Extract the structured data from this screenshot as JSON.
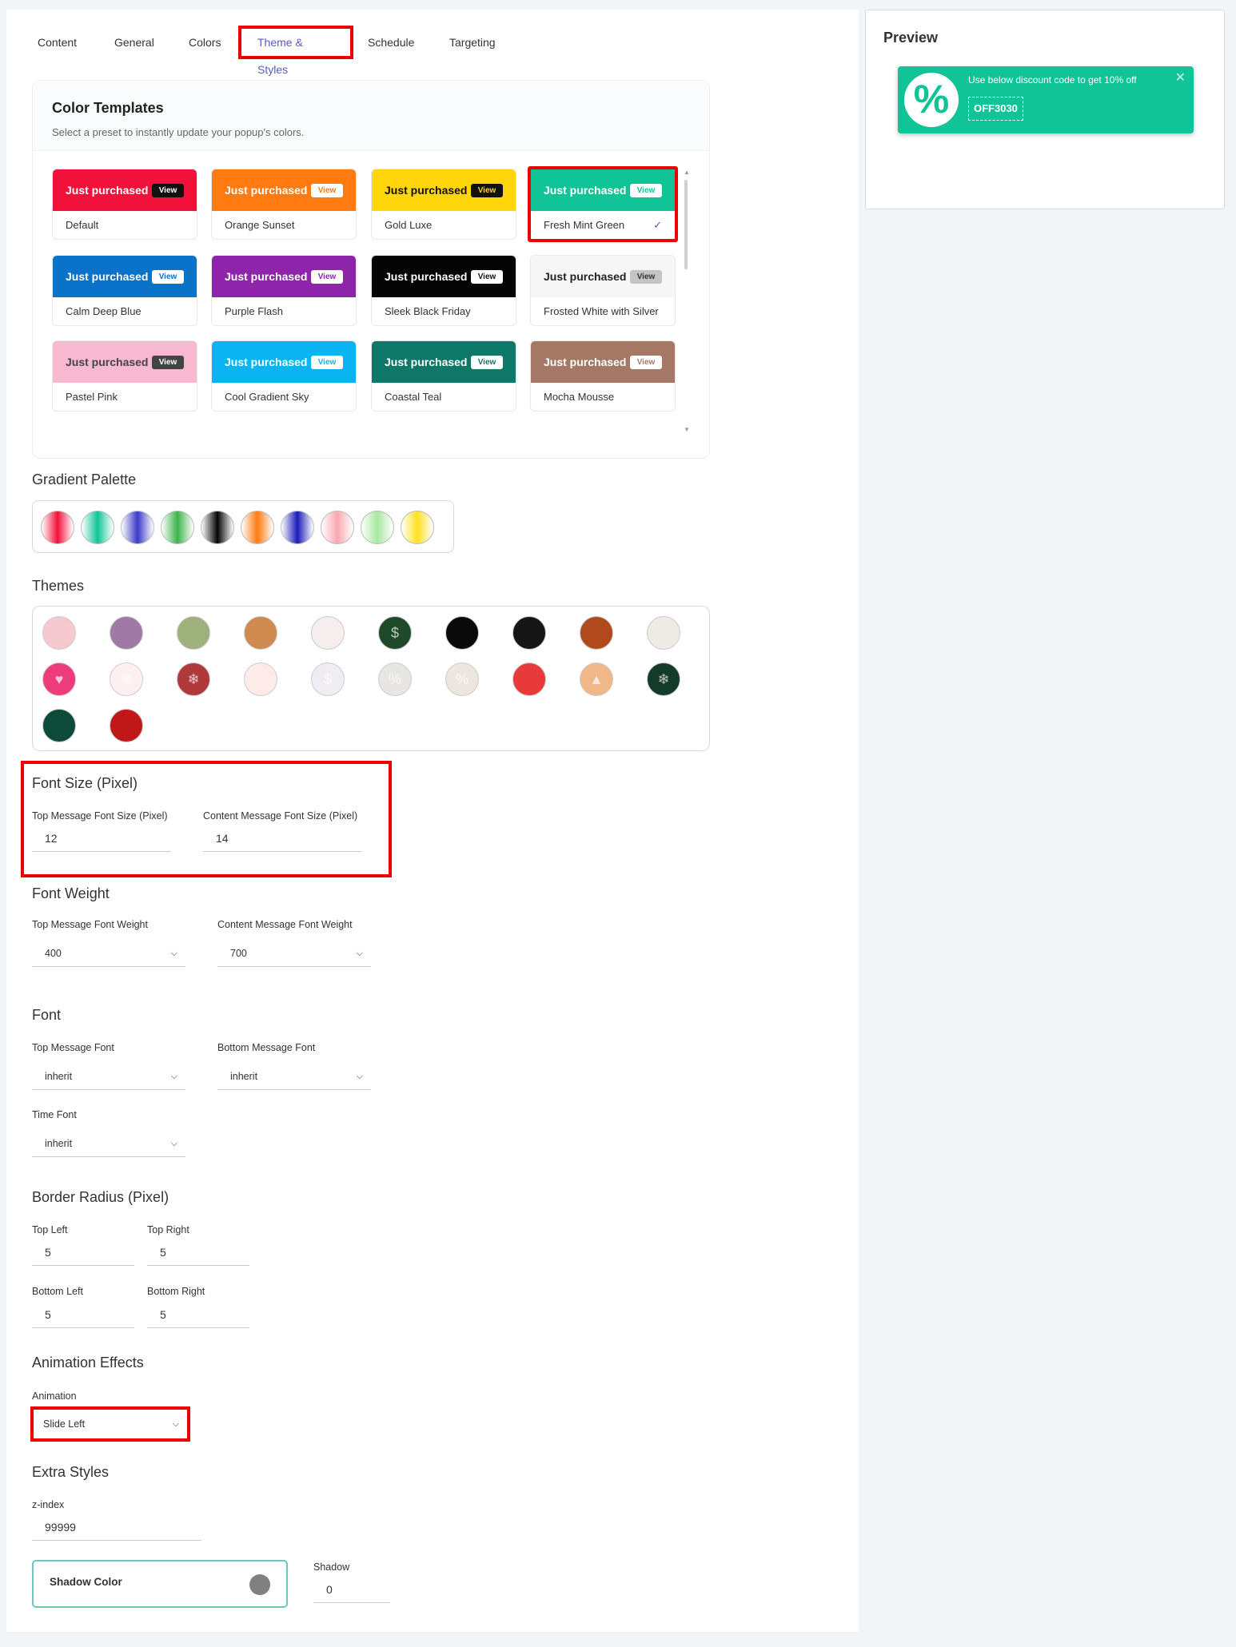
{
  "tabs": [
    "Content",
    "General",
    "Colors",
    "Theme & Styles",
    "Schedule",
    "Targeting"
  ],
  "color_templates": {
    "title": "Color Templates",
    "subtitle": "Select a preset to instantly update your popup's colors.",
    "badge_text": "Just purchased",
    "view_text": "View",
    "selected_check": "✓",
    "items": [
      {
        "name": "Default",
        "bg": "#f2113a",
        "fg": "#ffffff",
        "vbg": "#111111",
        "vfg": "#ffffff"
      },
      {
        "name": "Orange Sunset",
        "bg": "#ff7a10",
        "fg": "#ffffff",
        "vbg": "#ffffff",
        "vfg": "#ff7a10"
      },
      {
        "name": "Gold Luxe",
        "bg": "#ffd60a",
        "fg": "#111111",
        "vbg": "#111111",
        "vfg": "#ffd60a"
      },
      {
        "name": "Fresh Mint Green",
        "bg": "#10c498",
        "fg": "#ffffff",
        "vbg": "#ffffff",
        "vfg": "#10c498"
      },
      {
        "name": "Calm Deep Blue",
        "bg": "#0a72c8",
        "fg": "#ffffff",
        "vbg": "#ffffff",
        "vfg": "#0a72c8"
      },
      {
        "name": "Purple Flash",
        "bg": "#8e24aa",
        "fg": "#ffffff",
        "vbg": "#ffffff",
        "vfg": "#8e24aa"
      },
      {
        "name": "Sleek Black Friday",
        "bg": "#050505",
        "fg": "#ffffff",
        "vbg": "#ffffff",
        "vfg": "#111111"
      },
      {
        "name": "Frosted White with Silver",
        "bg": "#f6f6f6",
        "fg": "#222222",
        "vbg": "#c4c4c4",
        "vfg": "#333333"
      },
      {
        "name": "Pastel Pink",
        "bg": "#f8b8d0",
        "fg": "#444444",
        "vbg": "#444444",
        "vfg": "#ffffff"
      },
      {
        "name": "Cool Gradient Sky",
        "bg": "#0ab4f2",
        "fg": "#ffffff",
        "vbg": "#ffffff",
        "vfg": "#0ab4f2"
      },
      {
        "name": "Coastal Teal",
        "bg": "#0d7868",
        "fg": "#ffffff",
        "vbg": "#ffffff",
        "vfg": "#0d7868"
      },
      {
        "name": "Mocha Mousse",
        "bg": "#a57865",
        "fg": "#ffffff",
        "vbg": "#ffffff",
        "vfg": "#a57865"
      }
    ]
  },
  "gradient_palette": {
    "title": "Gradient Palette",
    "colors": [
      "#f2113a",
      "#10c498",
      "#3a3ac8",
      "#3cb44b",
      "#050505",
      "#ff7a10",
      "#1a1ab8",
      "#f8a8b0",
      "#a8e8a0",
      "#ffe020"
    ]
  },
  "themes": {
    "title": "Themes",
    "icons": [
      "pattern-pink-icon",
      "pattern-purple-icon",
      "pattern-olive-icon",
      "pattern-tan-icon",
      "sale-icon",
      "dollar-icon",
      "geometric-black-icon",
      "cart-icon",
      "pumpkin-icon",
      "christmas-tree-icon",
      "heart-icon",
      "snowflake-icon",
      "snowflake-red-icon",
      "gift-icon",
      "shopping-bag-icon",
      "percent-icon",
      "discount-icon",
      "ornament-icon",
      "tree-icon",
      "snowman-icon",
      "green-pattern-icon",
      "red-pattern-icon"
    ],
    "colors": [
      "#f5c9cf",
      "#a07aa6",
      "#9eb07c",
      "#cf8a50",
      "#f6eeee",
      "#1f4a2a",
      "#0a0a0a",
      "#151515",
      "#b04a1c",
      "#eeeae4",
      "#ee3b7a",
      "#fff0f0",
      "#b03a3a",
      "#fdebea",
      "#f0ecf4",
      "#e8e6e2",
      "#ede6df",
      "#e83a3a",
      "#f0b888",
      "#143a2a",
      "#0e4a3a",
      "#c01818"
    ],
    "glyphs": [
      "",
      "",
      "",
      "",
      "",
      "$",
      "",
      "",
      "",
      "",
      "♥",
      "❄",
      "❄",
      "",
      "$",
      "%",
      "%",
      "",
      "▲",
      "❄",
      "",
      ""
    ]
  },
  "font_size": {
    "title": "Font Size (Pixel)",
    "top_label": "Top Message Font Size (Pixel)",
    "top_value": "12",
    "content_label": "Content Message Font Size (Pixel)",
    "content_value": "14"
  },
  "font_weight": {
    "title": "Font Weight",
    "top_label": "Top Message Font Weight",
    "top_value": "400",
    "content_label": "Content Message Font Weight",
    "content_value": "700"
  },
  "font": {
    "title": "Font",
    "top_label": "Top Message Font",
    "top_value": "inherit",
    "bottom_label": "Bottom Message Font",
    "bottom_value": "inherit",
    "time_label": "Time Font",
    "time_value": "inherit"
  },
  "border_radius": {
    "title": "Border Radius (Pixel)",
    "top_left_label": "Top Left",
    "top_left": "5",
    "top_right_label": "Top Right",
    "top_right": "5",
    "bottom_left_label": "Bottom Left",
    "bottom_left": "5",
    "bottom_right_label": "Bottom Right",
    "bottom_right": "5"
  },
  "animation": {
    "title": "Animation Effects",
    "label": "Animation",
    "value": "Slide Left"
  },
  "extra_styles": {
    "title": "Extra Styles",
    "zindex_label": "z-index",
    "zindex_value": "99999",
    "shadow_color_label": "Shadow Color",
    "shadow_color": "#808080",
    "shadow_label": "Shadow",
    "shadow_value": "0"
  },
  "preview": {
    "title": "Preview",
    "message": "Use below discount code to get 10% off",
    "code": "OFF3030",
    "close": "✕",
    "icon": "%",
    "bg": "#10c498"
  }
}
